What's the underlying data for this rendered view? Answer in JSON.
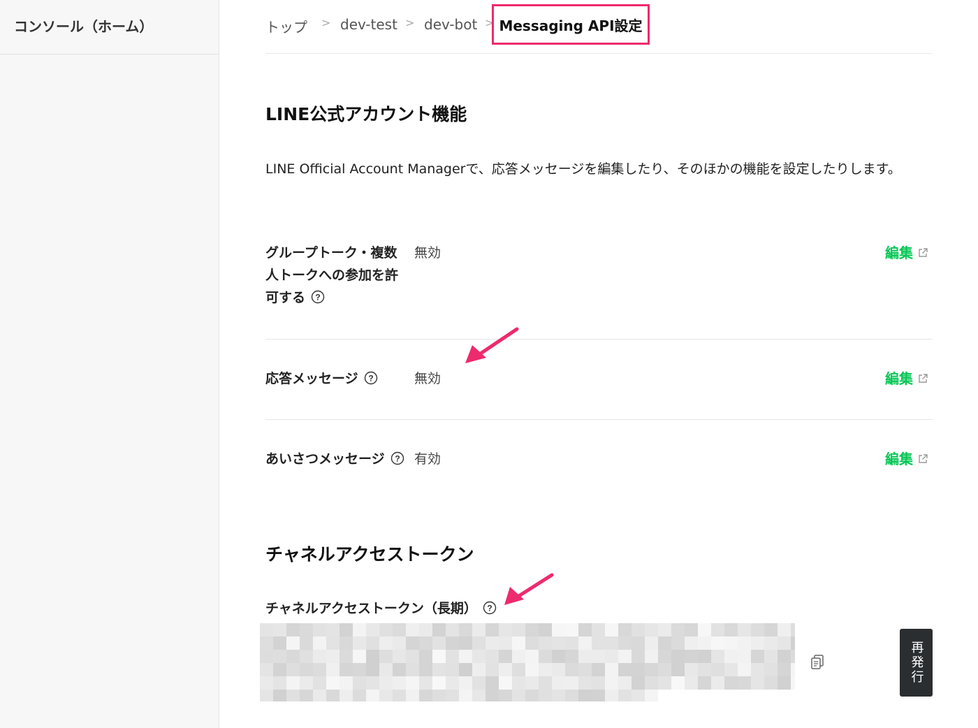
{
  "sidebar": {
    "title": "コンソール（ホーム）"
  },
  "breadcrumb": {
    "items": [
      "トップ",
      "dev-test",
      "dev-bot"
    ],
    "current": "Messaging API設定",
    "separator": ">"
  },
  "line_features": {
    "title": "LINE公式アカウント機能",
    "description": "LINE Official Account Managerで、応答メッセージを編集したり、そのほかの機能を設定したりします。",
    "rows": [
      {
        "label": "グループトーク・複数人トークへの参加を許可する",
        "value": "無効",
        "edit": "編集"
      },
      {
        "label": "応答メッセージ",
        "value": "無効",
        "edit": "編集"
      },
      {
        "label": "あいさつメッセージ",
        "value": "有効",
        "edit": "編集"
      }
    ]
  },
  "token_section": {
    "title": "チャネルアクセストークン",
    "label": "チャネルアクセストークン（長期）",
    "reissue": "再発行"
  },
  "colors": {
    "accent": "#06c755",
    "highlight": "#ee2a6e",
    "button": "#2b2e31"
  }
}
